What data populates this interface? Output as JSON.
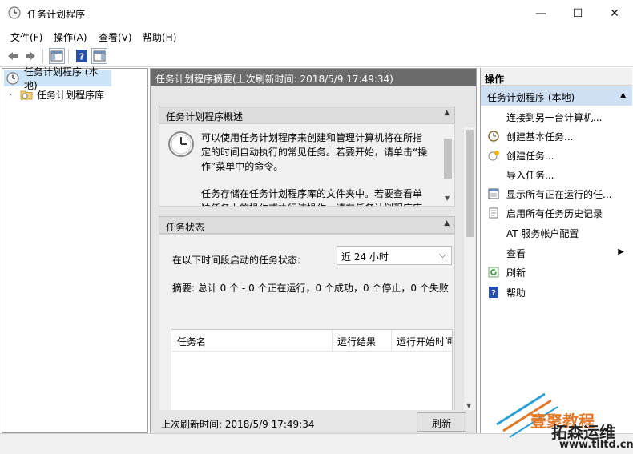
{
  "window": {
    "title": "任务计划程序",
    "minimize": "—",
    "maximize": "☐",
    "close": "✕"
  },
  "menu": [
    "文件(F)",
    "操作(A)",
    "查看(V)",
    "帮助(H)"
  ],
  "tree": {
    "root": "任务计划程序 (本地)",
    "library": "任务计划程序库"
  },
  "summary": {
    "header": "任务计划程序摘要(上次刷新时间: 2018/5/9 17:49:34)",
    "overview_title": "任务计划程序概述",
    "overview_p1": "可以使用任务计划程序来创建和管理计算机将在所指定的时间自动执行的常见任务。若要开始，请单击“操作”菜单中的命令。",
    "overview_p2": "任务存储在任务计划程序库的文件夹中。若要查看单独任务上的操作或执行该操作，请在任务计划程序库",
    "status_title": "任务状态",
    "status_period_label": "在以下时间段启动的任务状态:",
    "status_period_value": "近 24 小时",
    "status_summary": "摘要: 总计 0 个 - 0 个正在运行，0 个成功，0 个停止，0 个失败",
    "columns": [
      "任务名",
      "运行结果",
      "运行开始时间"
    ],
    "last_refresh": "上次刷新时间: 2018/5/9 17:49:34",
    "refresh_button": "刷新"
  },
  "actions": {
    "title": "操作",
    "group": "任务计划程序 (本地)",
    "items": [
      {
        "label": "连接到另一台计算机...",
        "icon": ""
      },
      {
        "label": "创建基本任务...",
        "icon": "basic-task-icon"
      },
      {
        "label": "创建任务...",
        "icon": "create-task-icon"
      },
      {
        "label": "导入任务...",
        "icon": ""
      },
      {
        "label": "显示所有正在运行的任...",
        "icon": "running-tasks-icon"
      },
      {
        "label": "启用所有任务历史记录",
        "icon": "history-icon"
      },
      {
        "label": "AT 服务帐户配置",
        "icon": ""
      },
      {
        "label": "查看",
        "icon": ""
      },
      {
        "label": "刷新",
        "icon": "refresh-icon"
      },
      {
        "label": "帮助",
        "icon": "help-icon"
      }
    ]
  },
  "watermark": {
    "line1": "壹聚教程",
    "line2": "拓森运维",
    "url": "www.tlltd.cn"
  }
}
